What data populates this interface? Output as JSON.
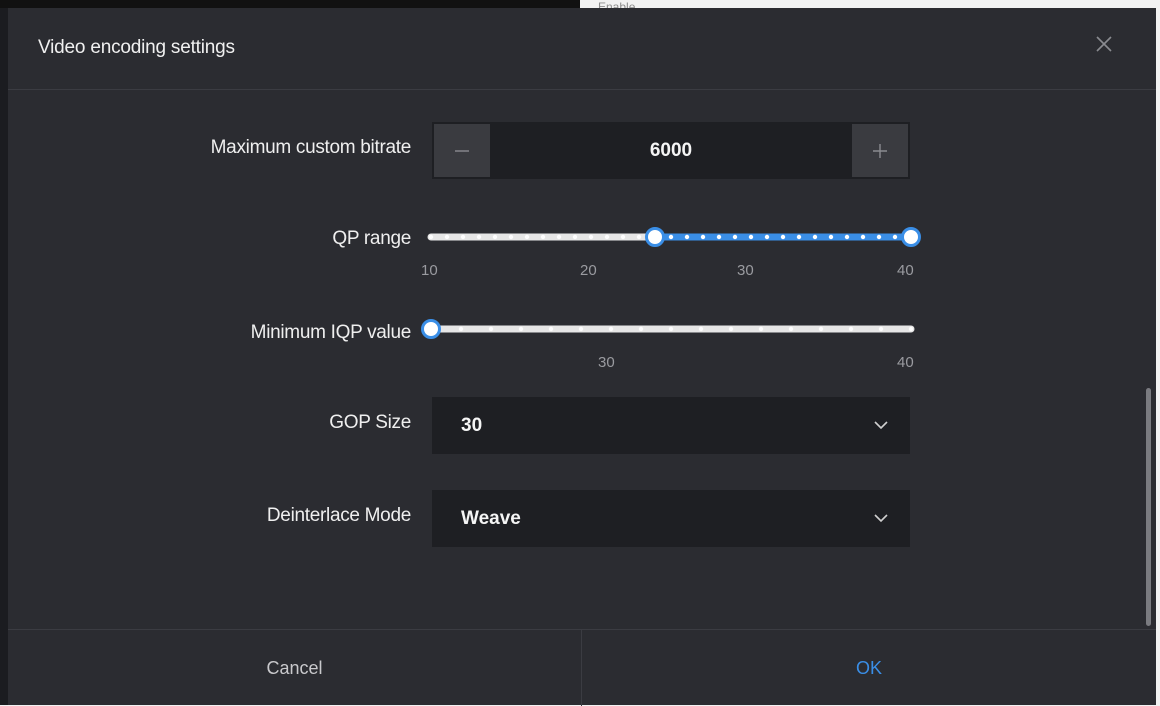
{
  "colors": {
    "accent": "#3a8ee6",
    "track": "#e6e6e6",
    "panel": "#2b2c31",
    "field": "#1e1f23"
  },
  "backdrop": {
    "peek_text": "Enable"
  },
  "dialog": {
    "title": "Video encoding settings",
    "close_icon": "close-icon",
    "fields": {
      "max_bitrate": {
        "label": "Maximum custom bitrate",
        "value": "6000",
        "decrement_icon": "minus-icon",
        "increment_icon": "plus-icon"
      },
      "qp_range": {
        "label": "QP range",
        "min": 10,
        "max": 40,
        "value_low": 24,
        "value_high": 40,
        "ticks": [
          "10",
          "20",
          "30",
          "40"
        ]
      },
      "min_iqp": {
        "label": "Minimum IQP value",
        "min": 24,
        "max": 40,
        "value": 24,
        "ticks": [
          "30",
          "40"
        ]
      },
      "gop_size": {
        "label": "GOP Size",
        "value": "30",
        "icon": "chevron-down-icon"
      },
      "deinterlace_mode": {
        "label": "Deinterlace Mode",
        "value": "Weave",
        "icon": "chevron-down-icon"
      }
    },
    "footer": {
      "cancel_label": "Cancel",
      "ok_label": "OK"
    }
  }
}
